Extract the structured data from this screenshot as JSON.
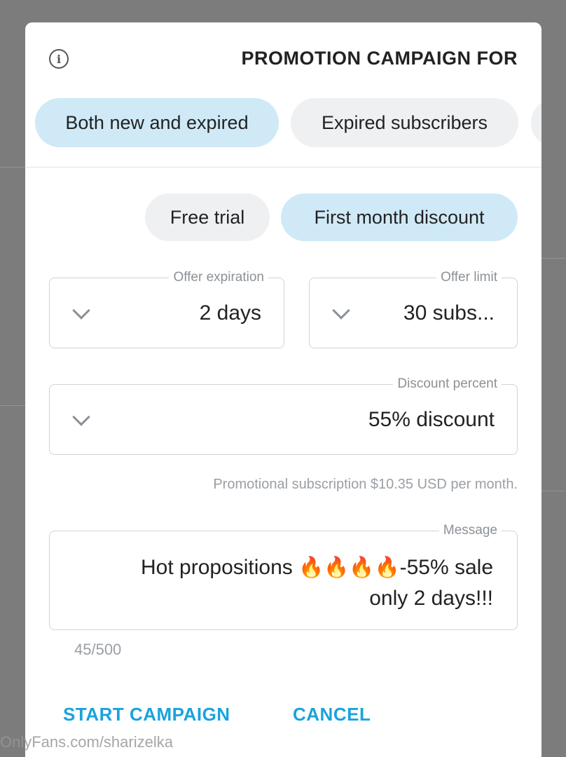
{
  "dialog": {
    "title": "PROMOTION CAMPAIGN FOR",
    "audience_options": [
      {
        "label": "Both new and expired",
        "selected": true
      },
      {
        "label": "Expired subscribers",
        "selected": false
      }
    ],
    "offer_type_options": [
      {
        "label": "First month discount",
        "selected": true
      },
      {
        "label": "Free trial",
        "selected": false
      }
    ],
    "offer_limit": {
      "label": "Offer limit",
      "value": "30 subs..."
    },
    "offer_expiration": {
      "label": "Offer expiration",
      "value": "2 days"
    },
    "discount_percent": {
      "label": "Discount percent",
      "value": "55% discount"
    },
    "promo_hint": "Promotional subscription $10.35 USD per month.",
    "message": {
      "label": "Message",
      "line1_text": "Hot propositions",
      "flames": [
        "🔥",
        "🔥",
        "🔥",
        "🔥"
      ],
      "line1_suffix": "-55% sale",
      "line2": "only 2 days!!!",
      "counter": "45/500"
    },
    "cancel_label": "CANCEL",
    "start_label": "START CAMPAIGN"
  },
  "watermark": "OnlyFans.com/sharizelka",
  "colors": {
    "accent": "#1aa3dc",
    "pill_selected": "#cfe9f7",
    "pill_default": "#eff0f2",
    "overlay": "#7c7c7c"
  }
}
